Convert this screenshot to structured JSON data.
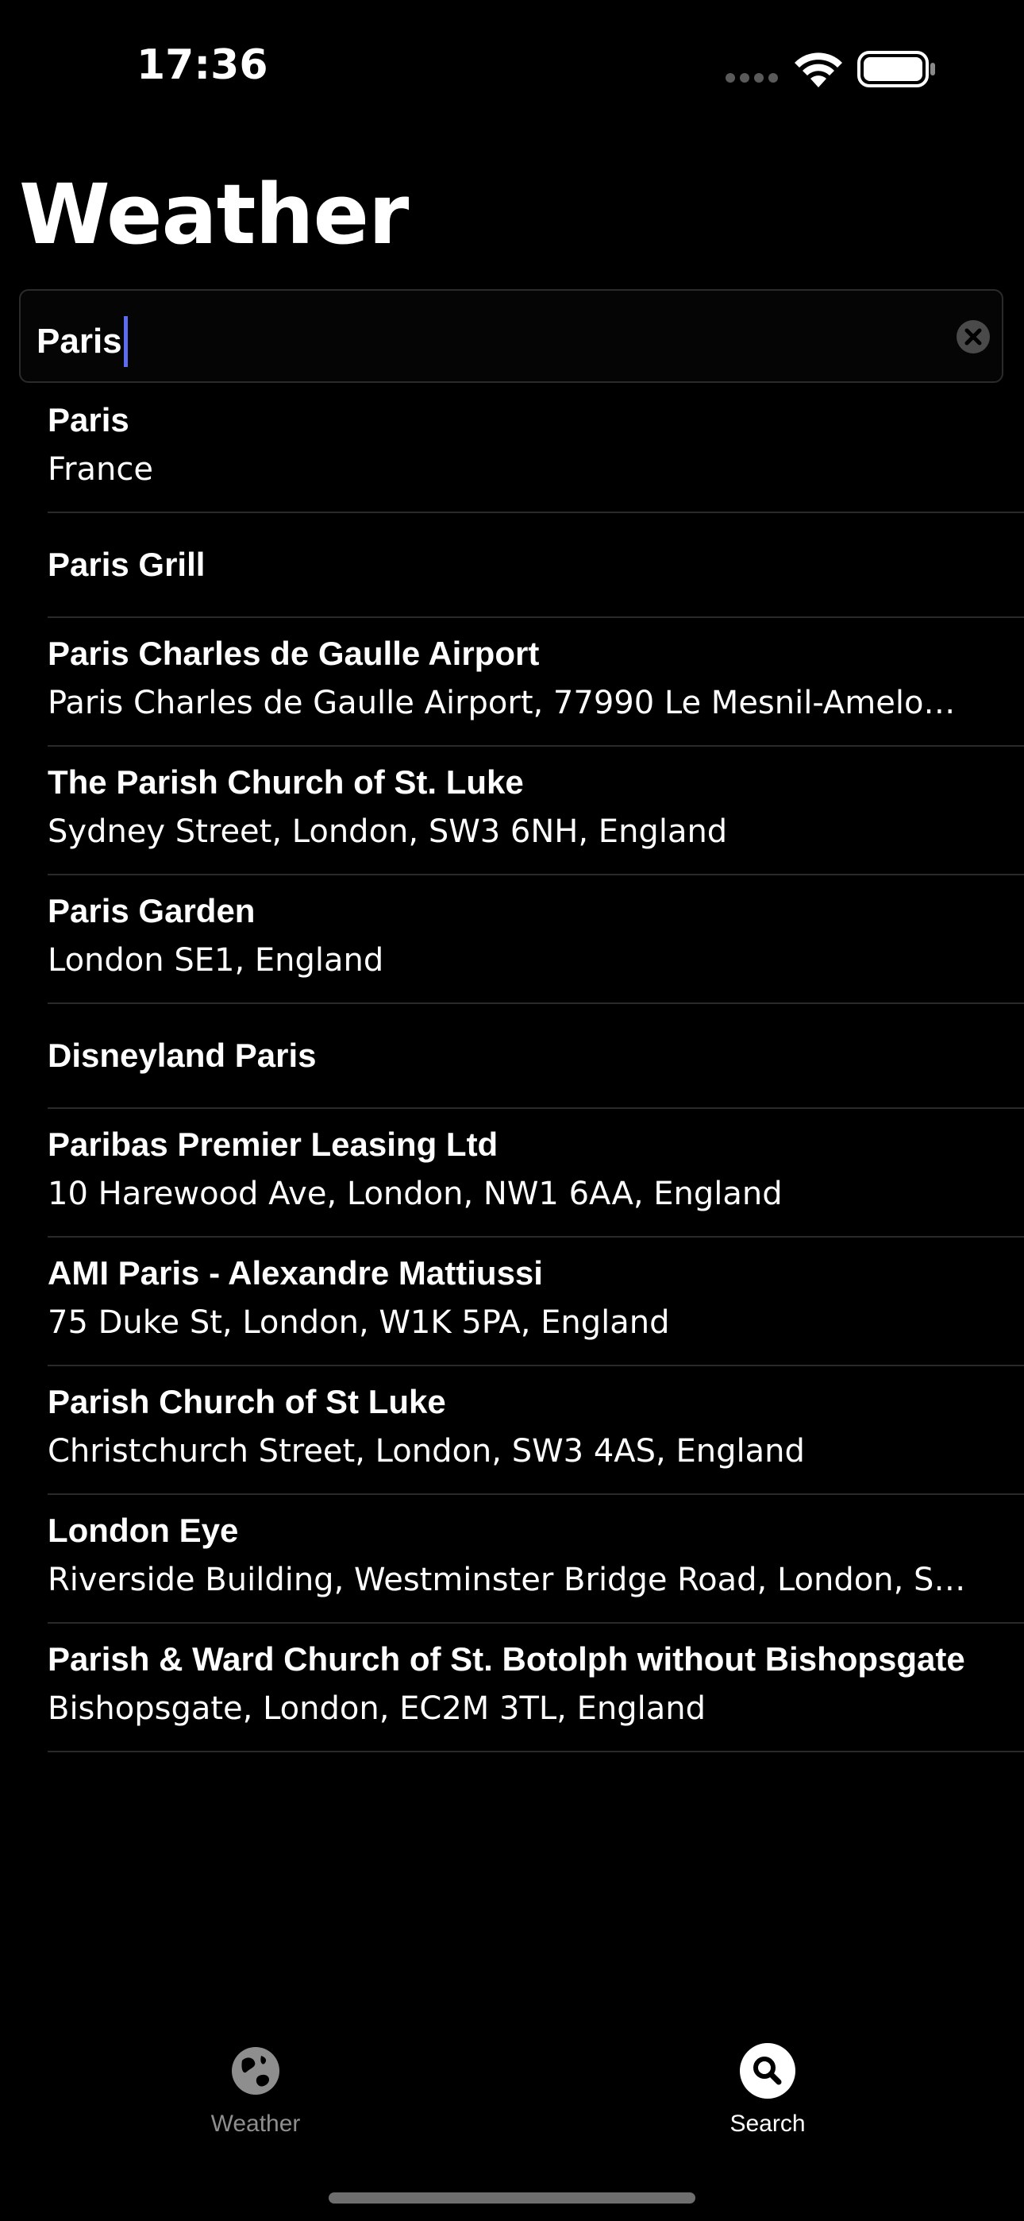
{
  "status_bar": {
    "time": "17:36"
  },
  "header": {
    "title": "Weather"
  },
  "search": {
    "value": "Paris"
  },
  "results": [
    {
      "title": "Paris",
      "subtitle": "France"
    },
    {
      "title": "Paris Grill",
      "subtitle": ""
    },
    {
      "title": "Paris Charles de Gaulle Airport",
      "subtitle": "Paris Charles de Gaulle Airport, 77990 Le Mesnil-Amelo…"
    },
    {
      "title": "The Parish Church of St. Luke",
      "subtitle": "Sydney Street, London, SW3 6NH, England"
    },
    {
      "title": "Paris Garden",
      "subtitle": "London SE1, England"
    },
    {
      "title": "Disneyland Paris",
      "subtitle": ""
    },
    {
      "title": "Paribas Premier Leasing Ltd",
      "subtitle": "10 Harewood Ave, London, NW1 6AA, England"
    },
    {
      "title": "AMI Paris - Alexandre Mattiussi",
      "subtitle": "75 Duke St, London, W1K 5PA, England"
    },
    {
      "title": "Parish Church of St Luke",
      "subtitle": "Christchurch Street, London, SW3 4AS, England"
    },
    {
      "title": "London Eye",
      "subtitle": "Riverside Building, Westminster Bridge Road, London, S…"
    },
    {
      "title": "Parish & Ward Church of St. Botolph without Bishopsgate",
      "subtitle": "Bishopsgate, London, EC2M 3TL, England"
    }
  ],
  "tab_bar": {
    "tabs": [
      {
        "label": "Weather",
        "icon": "globe-icon",
        "selected": false
      },
      {
        "label": "Search",
        "icon": "search-icon",
        "selected": true
      }
    ]
  },
  "colors": {
    "background": "#000000",
    "caret": "#5b6cf0",
    "divider": "#2a2a2a",
    "inactive_tab": "#8e8e8e"
  }
}
